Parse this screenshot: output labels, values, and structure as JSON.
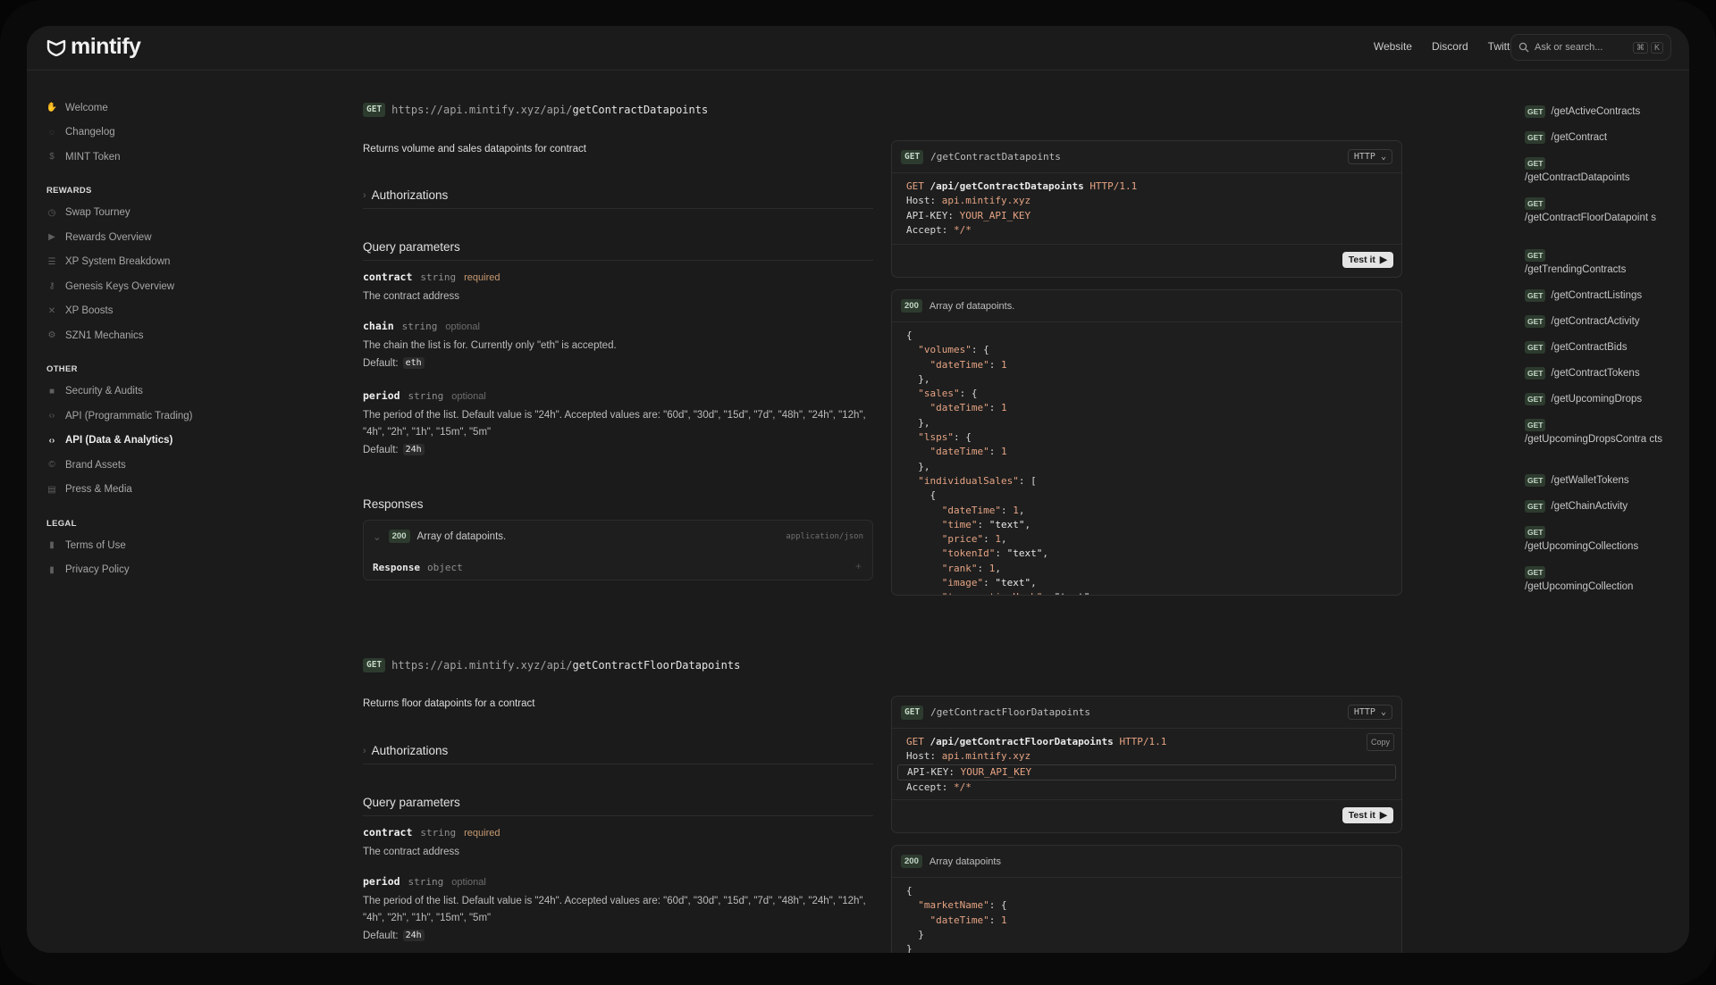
{
  "brand": {
    "name": "mintify"
  },
  "nav": {
    "links": [
      "Website",
      "Discord",
      "Twitter"
    ],
    "search_placeholder": "Ask or search...",
    "shortcut": [
      "⌘",
      "K"
    ]
  },
  "sidebar": {
    "top": [
      {
        "label": "Welcome",
        "icon": "wave-icon"
      },
      {
        "label": "Changelog",
        "icon": "changelog-icon"
      },
      {
        "label": "MINT Token",
        "icon": "dollar-icon"
      }
    ],
    "sections": [
      {
        "title": "REWARDS",
        "items": [
          {
            "label": "Swap Tourney",
            "icon": "clock-icon"
          },
          {
            "label": "Rewards Overview",
            "icon": "play-icon"
          },
          {
            "label": "XP System Breakdown",
            "icon": "sliders-icon"
          },
          {
            "label": "Genesis Keys Overview",
            "icon": "key-icon"
          },
          {
            "label": "XP Boosts",
            "icon": "cross-icon"
          },
          {
            "label": "SZN1 Mechanics",
            "icon": "gear-icon"
          }
        ]
      },
      {
        "title": "OTHER",
        "items": [
          {
            "label": "Security & Audits",
            "icon": "lock-icon"
          },
          {
            "label": "API (Programmatic Trading)",
            "icon": "code-icon"
          },
          {
            "label": "API (Data & Analytics)",
            "icon": "code-icon",
            "active": true
          },
          {
            "label": "Brand Assets",
            "icon": "copyright-icon"
          },
          {
            "label": "Press & Media",
            "icon": "newspaper-icon"
          }
        ]
      },
      {
        "title": "LEGAL",
        "items": [
          {
            "label": "Terms of Use",
            "icon": "file-icon"
          },
          {
            "label": "Privacy Policy",
            "icon": "file-icon"
          }
        ]
      }
    ]
  },
  "endpoint1": {
    "method": "GET",
    "url_base": "https://api.mintify.xyz/api/",
    "url_path": "getContractDatapoints",
    "description": "Returns volume and sales datapoints for contract",
    "auth_label": "Authorizations",
    "query_title": "Query parameters",
    "params": [
      {
        "name": "contract",
        "type": "string",
        "flag": "required",
        "desc": "The contract address"
      },
      {
        "name": "chain",
        "type": "string",
        "flag": "optional",
        "desc": "The chain the list is for. Currently only \"eth\" is accepted.",
        "default_label": "Default:",
        "default": "eth"
      },
      {
        "name": "period",
        "type": "string",
        "flag": "optional",
        "desc": "The period of the list. Default value is \"24h\". Accepted values are: \"60d\", \"30d\", \"15d\", \"7d\", \"48h\", \"24h\", \"12h\", \"4h\", \"2h\", \"1h\", \"15m\", \"5m\"",
        "default_label": "Default:",
        "default": "24h"
      }
    ],
    "responses_title": "Responses",
    "response": {
      "code": "200",
      "text": "Array of datapoints.",
      "content_type": "application/json",
      "field_name": "Response",
      "field_type": "object"
    },
    "panel": {
      "method": "GET",
      "path": "/getContractDatapoints",
      "lang": "HTTP",
      "request_line": {
        "method": "GET",
        "path": "/api/getContractDatapoints",
        "proto": "HTTP/1.1"
      },
      "headers": [
        {
          "k": "Host:",
          "v": "api.mintify.xyz"
        },
        {
          "k": "API-KEY:",
          "v": "YOUR_API_KEY"
        },
        {
          "k": "Accept:",
          "v": "*/*"
        }
      ],
      "test_label": "Test it"
    },
    "resp_panel": {
      "code": "200",
      "text": "Array of datapoints.",
      "lines": [
        "{",
        "  \"volumes\": {",
        "    \"dateTime\": 1",
        "  },",
        "  \"sales\": {",
        "    \"dateTime\": 1",
        "  },",
        "  \"lsps\": {",
        "    \"dateTime\": 1",
        "  },",
        "  \"individualSales\": [",
        "    {",
        "      \"dateTime\": 1,",
        "      \"time\": \"text\",",
        "      \"price\": 1,",
        "      \"tokenId\": \"text\",",
        "      \"rank\": 1,",
        "      \"image\": \"text\",",
        "      \"transactionHash\": \"text\","
      ]
    }
  },
  "endpoint2": {
    "method": "GET",
    "url_base": "https://api.mintify.xyz/api/",
    "url_path": "getContractFloorDatapoints",
    "description": "Returns floor datapoints for a contract",
    "auth_label": "Authorizations",
    "query_title": "Query parameters",
    "params": [
      {
        "name": "contract",
        "type": "string",
        "flag": "required",
        "desc": "The contract address"
      },
      {
        "name": "period",
        "type": "string",
        "flag": "optional",
        "desc": "The period of the list. Default value is \"24h\". Accepted values are: \"60d\", \"30d\", \"15d\", \"7d\", \"48h\", \"24h\", \"12h\", \"4h\", \"2h\", \"1h\", \"15m\", \"5m\"",
        "default_label": "Default:",
        "default": "24h"
      }
    ],
    "panel": {
      "method": "GET",
      "path": "/getContractFloorDatapoints",
      "lang": "HTTP",
      "request_line": {
        "method": "GET",
        "path": "/api/getContractFloorDatapoints",
        "proto": "HTTP/1.1"
      },
      "headers": [
        {
          "k": "Host:",
          "v": "api.mintify.xyz"
        },
        {
          "k": "API-KEY:",
          "v": "YOUR_API_KEY"
        },
        {
          "k": "Accept:",
          "v": "*/*"
        }
      ],
      "copy_label": "Copy",
      "test_label": "Test it"
    },
    "resp_panel": {
      "code": "200",
      "text": "Array datapoints",
      "lines": [
        "{",
        "  \"marketName\": {",
        "    \"dateTime\": 1",
        "  }",
        "}"
      ]
    }
  },
  "toc": [
    {
      "method": "GET",
      "path": "/getActiveContracts"
    },
    {
      "method": "GET",
      "path": "/getContract"
    },
    {
      "method": "GET",
      "path": "/getContractDatapoints",
      "wrap": true
    },
    {
      "method": "GET",
      "path": "/getContractFloorDatapoint s",
      "wrap": true
    },
    {
      "method": "GET",
      "path": "/getTrendingContracts",
      "wrap": true
    },
    {
      "method": "GET",
      "path": "/getContractListings"
    },
    {
      "method": "GET",
      "path": "/getContractActivity"
    },
    {
      "method": "GET",
      "path": "/getContractBids"
    },
    {
      "method": "GET",
      "path": "/getContractTokens"
    },
    {
      "method": "GET",
      "path": "/getUpcomingDrops"
    },
    {
      "method": "GET",
      "path": "/getUpcomingDropsContra cts",
      "wrap": true
    },
    {
      "method": "GET",
      "path": "/getWalletTokens"
    },
    {
      "method": "GET",
      "path": "/getChainActivity"
    },
    {
      "method": "GET",
      "path": "/getUpcomingCollections",
      "wrap": true
    },
    {
      "method": "GET",
      "path": "/getUpcomingCollection",
      "wrap": true
    }
  ]
}
